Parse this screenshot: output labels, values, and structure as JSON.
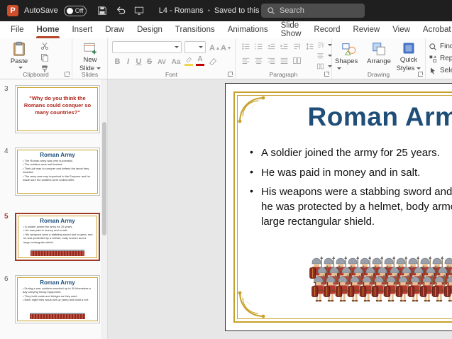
{
  "titlebar": {
    "autosave_label": "AutoSave",
    "autosave_state": "Off",
    "doc_title": "L4 - Romans",
    "separator": "•",
    "doc_status": "Saved to this PC",
    "search_placeholder": "Search"
  },
  "icons": {
    "logo_letter": "P"
  },
  "tabs": {
    "items": [
      "File",
      "Home",
      "Insert",
      "Draw",
      "Design",
      "Transitions",
      "Animations",
      "Slide Show",
      "Record",
      "Review",
      "View",
      "Acrobat"
    ],
    "active": "Home"
  },
  "ribbon": {
    "clipboard": {
      "paste": "Paste",
      "label": "Clipboard"
    },
    "slides": {
      "new_line1": "New",
      "new_line2": "Slide",
      "label": "Slides"
    },
    "font": {
      "bold": "B",
      "italic": "I",
      "underline": "U",
      "strikethrough": "S",
      "kerning": "AV",
      "case": "Aa",
      "grow": "A",
      "shrink": "A",
      "font_color": "A",
      "label": "Font"
    },
    "paragraph": {
      "label": "Paragraph"
    },
    "drawing": {
      "shapes": "Shapes",
      "arrange": "Arrange",
      "quick_line1": "Quick",
      "quick_line2": "Styles",
      "label": "Drawing"
    },
    "editing": {
      "find": "Find",
      "replace": "Replace",
      "select": "Select"
    }
  },
  "panel": {
    "slides": [
      {
        "number": "3",
        "text": "\"Why do you think the Romans could conquer so many countries?\""
      },
      {
        "number": "4",
        "title": "Roman Army",
        "lines": [
          "The Roman army was very successful.",
          "The soldiers were well trained.",
          "Their job was to conquer and defend the lands they invaded.",
          "The army was very important to the Emperor and he made sure the soldiers were looked after."
        ]
      },
      {
        "number": "5",
        "title": "Roman Army",
        "lines": [
          "A soldier joined the army for 25 years.",
          "He was paid in money and in salt.",
          "His weapons were a stabbing sword and a spear, and he was protected by a helmet, body armour and a large rectangular shield."
        ]
      },
      {
        "number": "6",
        "title": "Roman Army",
        "lines": [
          "During a war, soldiers marched up to 30 kilometres a day carrying heavy equipment.",
          "They built roads and bridges as they went.",
          "Each night they would set up camp and build a fort."
        ]
      }
    ]
  },
  "slide": {
    "title": "Roman Army",
    "bullets": [
      "A soldier joined the army for 25 years.",
      "He was paid in money and in salt.",
      "His weapons were a stabbing sword and a spear, and\nhe was protected by a helmet, body armour and a\nlarge rectangular shield."
    ]
  },
  "colors": {
    "accent_red": "#B7472A",
    "title_blue": "#1F4E79",
    "gold": "#C8A02A",
    "selection_red": "#9E3A26",
    "quote_red": "#B02418"
  }
}
